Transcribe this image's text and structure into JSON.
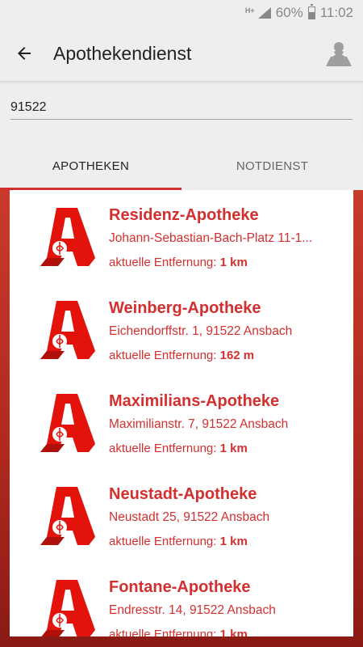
{
  "status_bar": {
    "network": "H+",
    "battery": "60%",
    "time": "11:02"
  },
  "app_bar": {
    "title": "Apothekendienst",
    "back_icon": "arrow-left-icon",
    "map_icon": "map-marker-icon"
  },
  "search": {
    "value": "91522",
    "placeholder": ""
  },
  "tabs": [
    {
      "label": "APOTHEKEN",
      "active": true
    },
    {
      "label": "NOTDIENST",
      "active": false
    }
  ],
  "pharmacies": [
    {
      "name": "Residenz-Apotheke",
      "address": "Johann-Sebastian-Bach-Platz 11-1...",
      "distance_label": "aktuelle Entfernung:",
      "distance": "1 km"
    },
    {
      "name": "Weinberg-Apotheke",
      "address": "Eichendorffstr. 1, 91522 Ansbach",
      "distance_label": "aktuelle Entfernung:",
      "distance": "162 m"
    },
    {
      "name": "Maximilians-Apotheke",
      "address": "Maximilianstr. 7, 91522 Ansbach",
      "distance_label": "aktuelle Entfernung:",
      "distance": "1 km"
    },
    {
      "name": "Neustadt-Apotheke",
      "address": "Neustadt 25, 91522 Ansbach",
      "distance_label": "aktuelle Entfernung:",
      "distance": "1 km"
    },
    {
      "name": "Fontane-Apotheke",
      "address": "Endresstr. 14, 91522 Ansbach",
      "distance_label": "aktuelle Entfernung:",
      "distance": "1 km"
    }
  ],
  "colors": {
    "accent": "#d32f2f",
    "background": "#eeeeee"
  }
}
